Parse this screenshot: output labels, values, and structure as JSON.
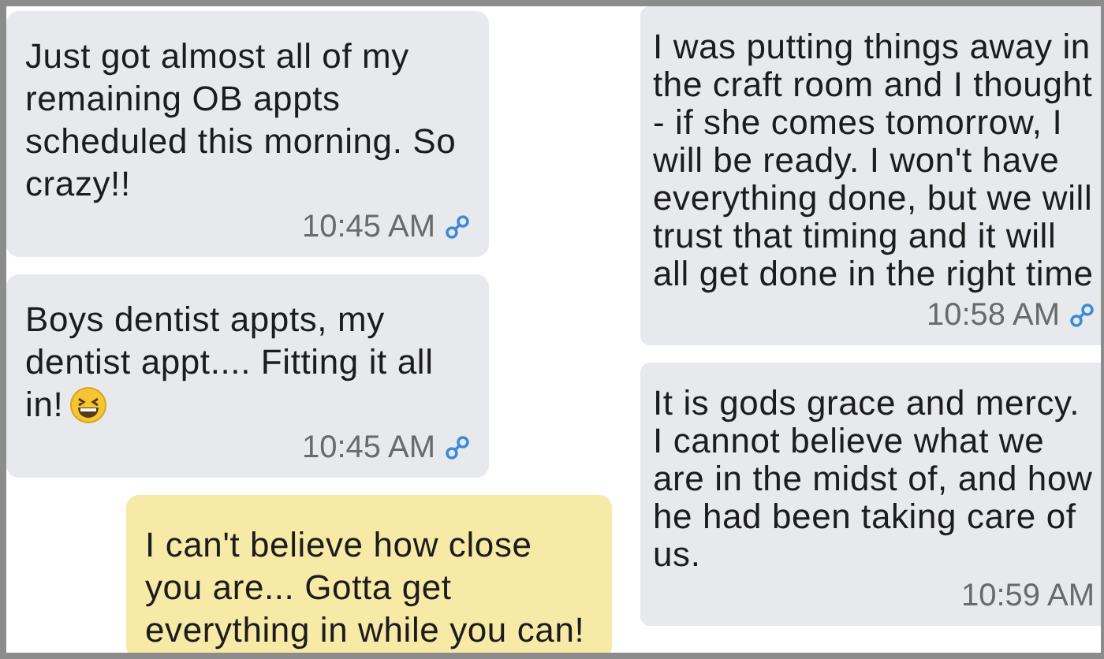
{
  "panels": [
    {
      "messages": [
        {
          "kind": "received",
          "text": "Just got almost all of my remaining OB appts scheduled this morning. So crazy!!",
          "emoji": false,
          "time": "10:45 AM",
          "linked": true
        },
        {
          "kind": "received",
          "text": "Boys dentist appts, my dentist appt.... Fitting it all in!",
          "emoji": true,
          "time": "10:45 AM",
          "linked": true
        },
        {
          "kind": "sent",
          "text": "I can't believe how close you are... Gotta get everything in while you can!",
          "emoji": false,
          "linked": false
        }
      ]
    },
    {
      "messages": [
        {
          "kind": "received",
          "text": "I was putting things away in the craft room and I thought - if she comes tomorrow, I will be ready. I won't have everything done, but we will trust that timing and it will all get done in the right time",
          "emoji": false,
          "time": "10:58 AM",
          "linked": true
        },
        {
          "kind": "received",
          "text": "It is gods grace and mercy. I cannot believe what we are in the midst of, and how he had been taking care of us.",
          "emoji": false,
          "time": "10:59 AM",
          "linked": false
        }
      ]
    }
  ]
}
